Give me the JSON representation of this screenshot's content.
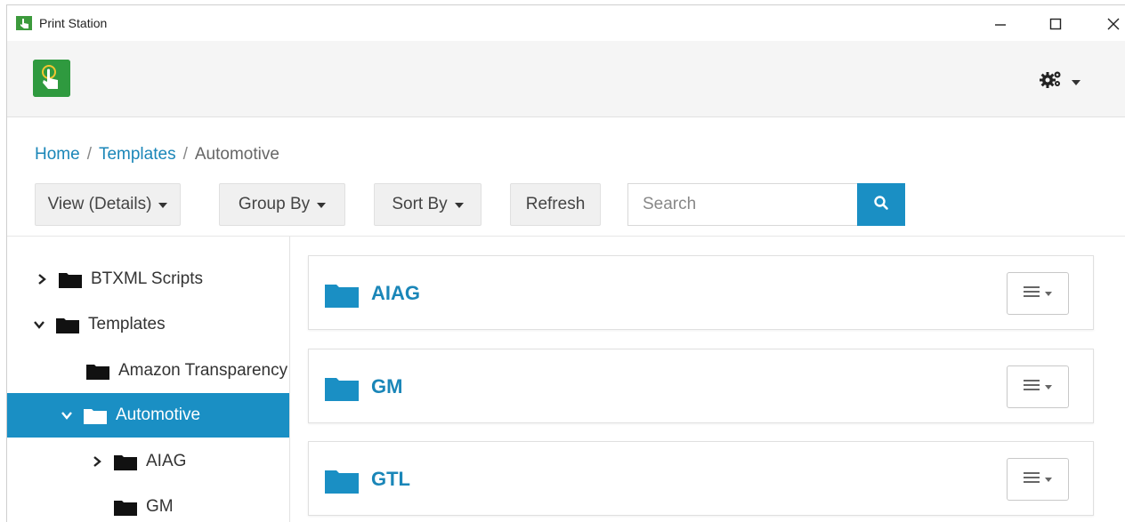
{
  "window": {
    "title": "Print Station",
    "minimize": "—",
    "maximize": "☐",
    "close": "✕"
  },
  "colors": {
    "accent": "#1a8fc4",
    "brand_green": "#2f9a3f",
    "link": "#1a86b8"
  },
  "header": {
    "logo_icon": "touch-hand-icon",
    "settings_icon": "gears-icon"
  },
  "breadcrumb": {
    "items": [
      "Home",
      "Templates"
    ],
    "current": "Automotive",
    "separator": "/"
  },
  "toolbar": {
    "view_label": "View (Details)",
    "group_label": "Group By",
    "sort_label": "Sort By",
    "refresh_label": "Refresh",
    "search_placeholder": "Search"
  },
  "tree": {
    "items": [
      {
        "label": "BTXML Scripts",
        "state": "collapsed"
      },
      {
        "label": "Templates",
        "state": "expanded"
      },
      {
        "label": "Amazon Transparency",
        "state": "leaf"
      },
      {
        "label": "Automotive",
        "state": "expanded-selected"
      },
      {
        "label": "AIAG",
        "state": "collapsed"
      },
      {
        "label": "GM",
        "state": "leaf"
      }
    ]
  },
  "folders": [
    {
      "name": "AIAG"
    },
    {
      "name": "GM"
    },
    {
      "name": "GTL"
    }
  ]
}
